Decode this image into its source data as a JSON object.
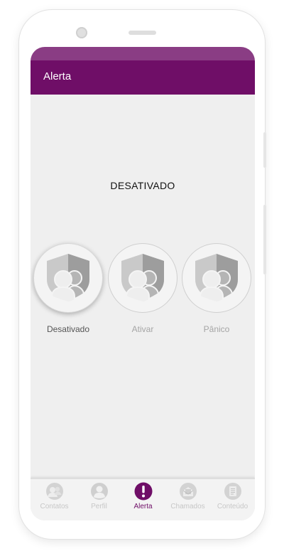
{
  "colors": {
    "primary": "#6f0e67",
    "status_bar": "#8a3d84",
    "background": "#efefef",
    "inactive": "#c7c7c7"
  },
  "header": {
    "title": "Alerta"
  },
  "status": {
    "text": "DESATIVADO"
  },
  "alert_buttons": [
    {
      "label": "Desativado",
      "icon": "shield-people-icon",
      "selected": true
    },
    {
      "label": "Ativar",
      "icon": "shield-people-icon",
      "selected": false
    },
    {
      "label": "Pânico",
      "icon": "shield-people-icon",
      "selected": false
    }
  ],
  "bottom_nav": {
    "items": [
      {
        "label": "Contatos",
        "icon": "contacts-icon"
      },
      {
        "label": "Perfil",
        "icon": "profile-icon"
      },
      {
        "label": "Alerta",
        "icon": "alert-icon",
        "active": true
      },
      {
        "label": "Chamados",
        "icon": "calls-icon"
      },
      {
        "label": "Conteúdo",
        "icon": "content-icon"
      }
    ]
  }
}
